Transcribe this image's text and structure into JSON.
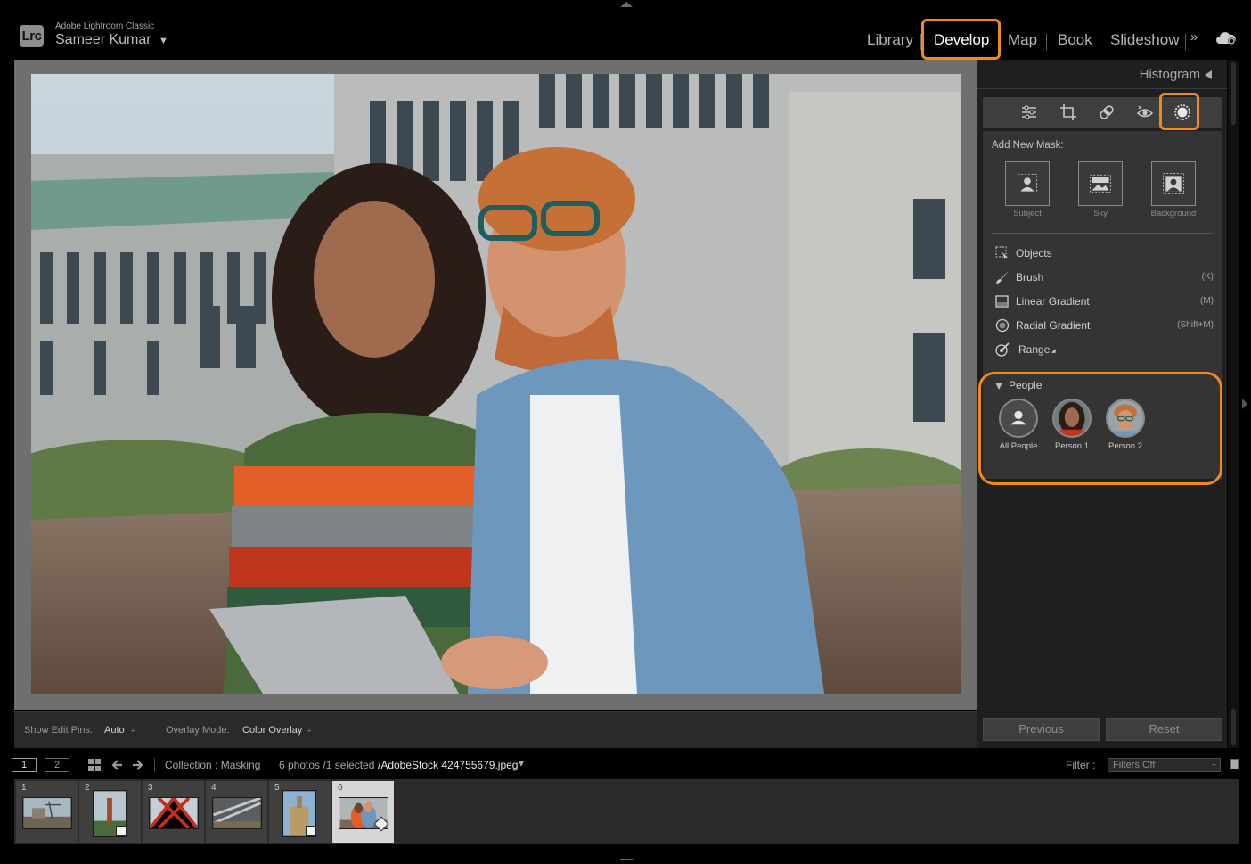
{
  "app": {
    "name": "Adobe Lightroom Classic",
    "logo_text": "Lrc",
    "user": "Sameer Kumar"
  },
  "modules": [
    {
      "label": "Library",
      "active": false
    },
    {
      "label": "Develop",
      "active": true
    },
    {
      "label": "Map",
      "active": false
    },
    {
      "label": "Book",
      "active": false
    },
    {
      "label": "Slideshow",
      "active": false
    }
  ],
  "more_modules": "»",
  "right_panel": {
    "histogram_title": "Histogram",
    "tool_icons": [
      "sliders-icon",
      "crop-icon",
      "healing-icon",
      "red-eye-icon",
      "masking-icon"
    ],
    "add_new_mask_label": "Add New Mask:",
    "mask_buttons": [
      {
        "label": "Subject",
        "icon": "subject-mask-icon"
      },
      {
        "label": "Sky",
        "icon": "sky-mask-icon"
      },
      {
        "label": "Background",
        "icon": "background-mask-icon"
      }
    ],
    "mask_tools": [
      {
        "label": "Objects",
        "shortcut": "",
        "icon": "objects-icon"
      },
      {
        "label": "Brush",
        "shortcut": "(K)",
        "icon": "brush-icon"
      },
      {
        "label": "Linear Gradient",
        "shortcut": "(M)",
        "icon": "linear-gradient-icon"
      },
      {
        "label": "Radial Gradient",
        "shortcut": "(Shift+M)",
        "icon": "radial-gradient-icon"
      },
      {
        "label": "Range",
        "shortcut": "",
        "icon": "range-icon",
        "submenu_marker": "◢"
      }
    ],
    "people": {
      "title": "People",
      "items": [
        {
          "label": "All People",
          "icon": "all-people-icon"
        },
        {
          "label": "Person 1",
          "icon": "person-1-avatar"
        },
        {
          "label": "Person 2",
          "icon": "person-2-avatar"
        }
      ]
    },
    "buttons": {
      "previous": "Previous",
      "reset": "Reset"
    }
  },
  "toolbar": {
    "show_edit_pins_label": "Show Edit Pins:",
    "show_edit_pins_value": "Auto",
    "overlay_mode_label": "Overlay Mode:",
    "overlay_mode_value": "Color Overlay",
    "spinner": "÷"
  },
  "filmstrip_bar": {
    "screen1": "1",
    "screen2": "2",
    "collection": "Collection : Masking",
    "count": "6 photos /1 selected",
    "filename": "/AdobeStock 424755679.jpeg",
    "filename_caret": "▾",
    "filter_label": "Filter :",
    "filter_value": "Filters Off",
    "filter_spinner": "÷"
  },
  "filmstrip": {
    "numbers": [
      "1",
      "2",
      "3",
      "4",
      "5",
      "6"
    ],
    "selected_index": 6
  },
  "colors": {
    "accent_highlight": "#f08a1c",
    "panel_bg": "#343434",
    "app_bg": "#000000"
  }
}
